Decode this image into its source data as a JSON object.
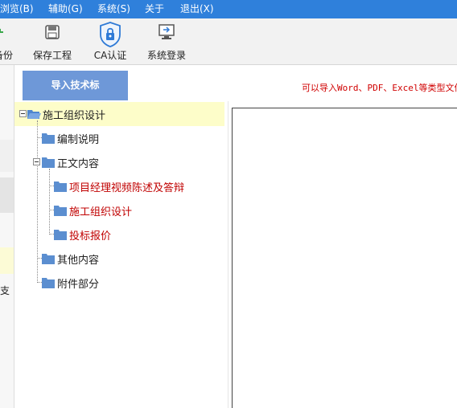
{
  "menu": [
    {
      "label": "浏览(B)"
    },
    {
      "label": "辅助(G)"
    },
    {
      "label": "系统(S)"
    },
    {
      "label": "关于"
    },
    {
      "label": "退出(X)"
    }
  ],
  "toolbar": {
    "backup_label": "备份",
    "save_label": "保存工程",
    "ca_label": "CA认证",
    "login_label": "系统登录"
  },
  "left_panel": {
    "partial_text": "支"
  },
  "import_button": "导入技术标",
  "hint": "可以导入Word、PDF、Excel等类型文件",
  "tree": {
    "root": "施工组织设计",
    "n1": "编制说明",
    "n2": "正文内容",
    "n2a": "项目经理视频陈述及答辩",
    "n2b": "施工组织设计",
    "n2c": "投标报价",
    "n3": "其他内容",
    "n4": "附件部分"
  },
  "colors": {
    "menubar": "#2f80db",
    "accent_button": "#6e98d8",
    "folder": "#5b8ed0",
    "highlight_text": "#c00000",
    "selection": "#fdfdc9"
  }
}
